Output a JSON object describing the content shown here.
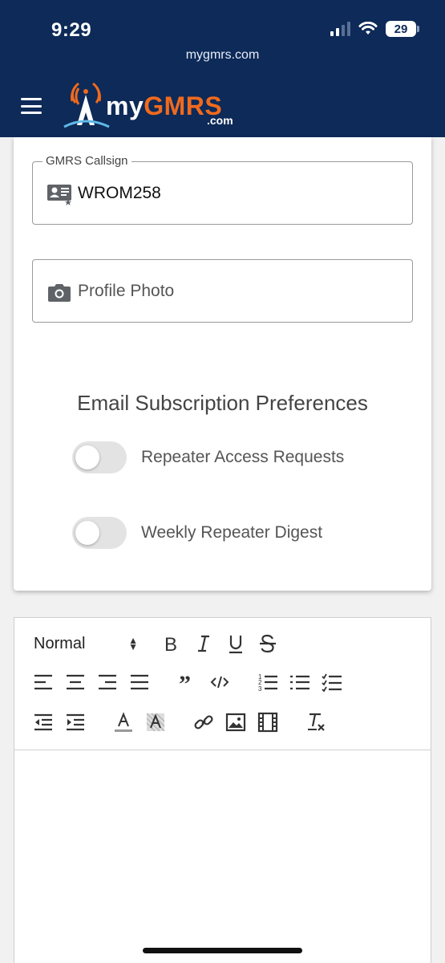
{
  "status_bar": {
    "time": "9:29",
    "battery": "29"
  },
  "browser": {
    "url": "mygmrs.com"
  },
  "site": {
    "logo_my": "my",
    "logo_gmrs": "GMRS",
    "logo_com": ".com"
  },
  "profile": {
    "callsign": {
      "label": "GMRS Callsign",
      "value": "WROM258",
      "icon": "id-card-icon"
    },
    "photo": {
      "placeholder": "Profile Photo",
      "icon": "camera-icon"
    }
  },
  "email_prefs": {
    "title": "Email Subscription Preferences",
    "options": [
      {
        "label": "Repeater Access Requests",
        "checked": false
      },
      {
        "label": "Weekly Repeater Digest",
        "checked": false
      }
    ]
  },
  "editor": {
    "format_select": "Normal",
    "row1": [
      "bold-icon",
      "italic-icon",
      "underline-icon",
      "strikethrough-icon"
    ],
    "row2": [
      "align-left-icon",
      "align-center-icon",
      "align-right-icon",
      "align-justify-icon",
      "blockquote-icon",
      "code-block-icon",
      "ordered-list-icon",
      "bullet-list-icon",
      "checklist-icon"
    ],
    "row3": [
      "outdent-icon",
      "indent-icon",
      "text-color-icon",
      "background-color-icon",
      "link-icon",
      "image-icon",
      "video-icon",
      "clear-format-icon"
    ]
  },
  "colors": {
    "header": "#0d2a58",
    "logo_accent": "#f06a1e"
  }
}
